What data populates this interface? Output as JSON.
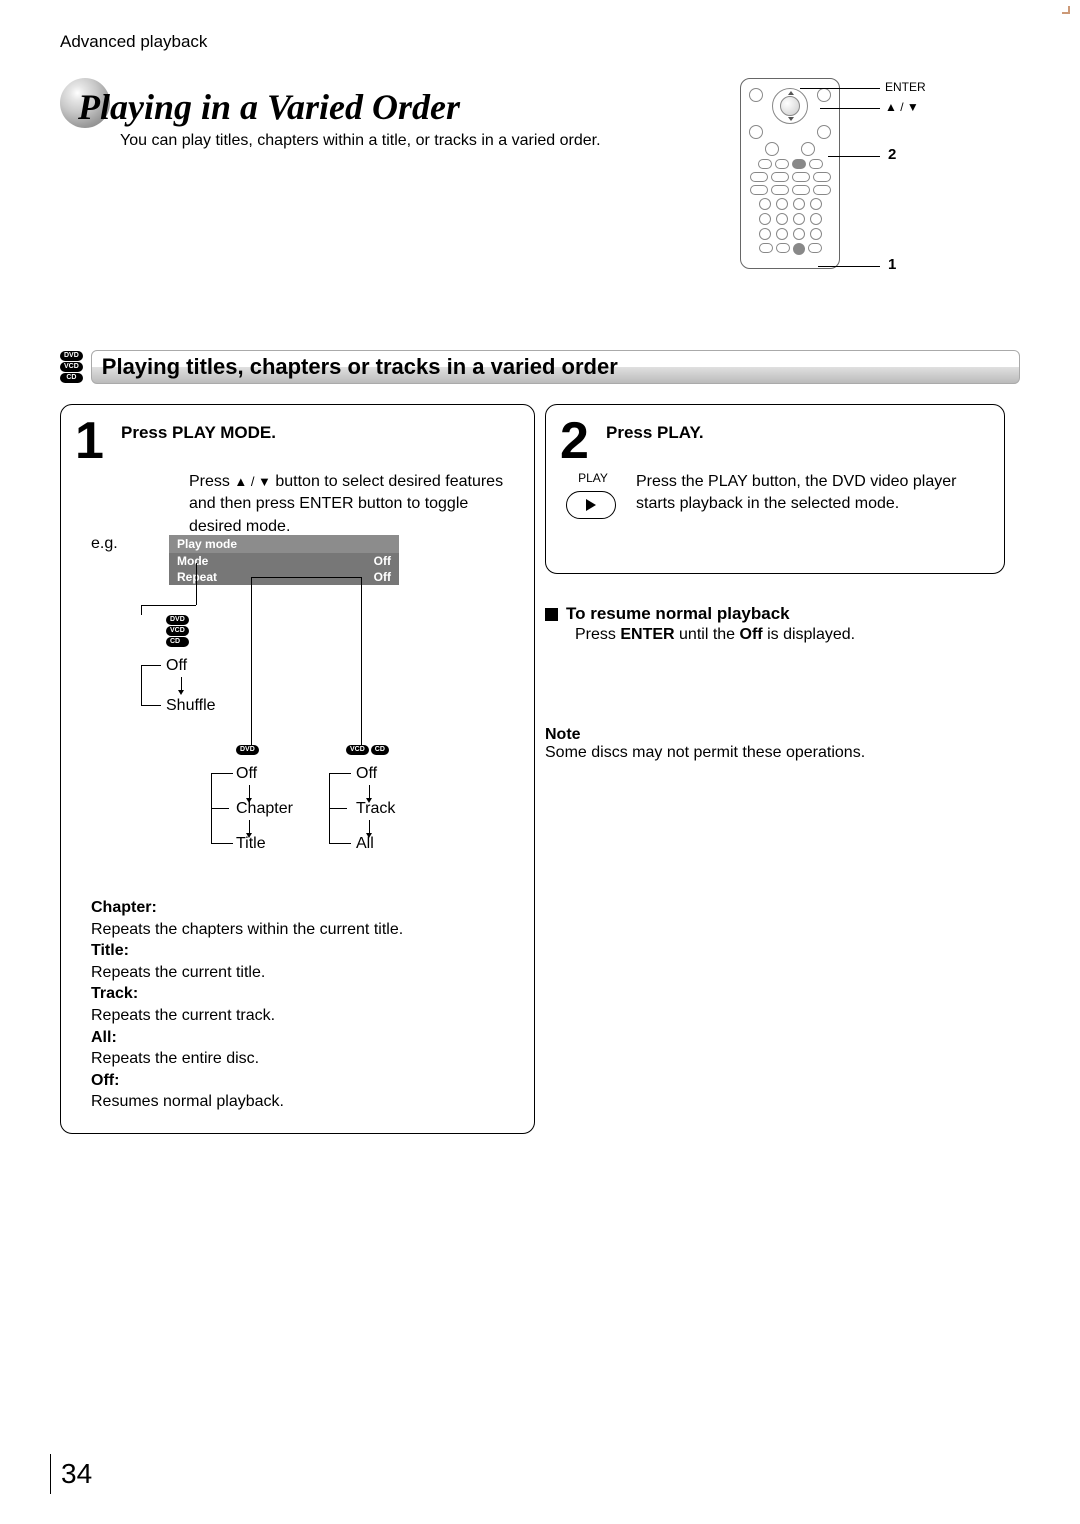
{
  "header": {
    "section": "Advanced playback",
    "title": "Playing in a Varied Order",
    "subtitle": "You can play titles, chapters within a title, or tracks in a varied order."
  },
  "remote_callouts": {
    "enter": "ENTER",
    "arrows": "▲ / ▼",
    "ref2": "2",
    "ref1": "1"
  },
  "disc_types": [
    "DVD",
    "VCD",
    "CD"
  ],
  "subheading": "Playing titles, chapters or tracks in a varied order",
  "step1": {
    "title": "Press PLAY MODE.",
    "instruction_pre": "Press ",
    "instruction_mid": " button to select desired features and then press ENTER button to toggle desired mode.",
    "eg": "e.g.",
    "osd": {
      "head": "Play mode",
      "rows": [
        {
          "label": "Mode",
          "value": "Off"
        },
        {
          "label": "Repeat",
          "value": "Off"
        }
      ]
    },
    "mode_branch": {
      "badges": [
        "DVD",
        "VCD",
        "CD"
      ],
      "opt1": "Off",
      "opt2": "Shuffle"
    },
    "repeat_branch_left": {
      "badges": [
        "DVD"
      ],
      "opt1": "Off",
      "opt2": "Chapter",
      "opt3": "Title"
    },
    "repeat_branch_right": {
      "badges": [
        "VCD",
        "CD"
      ],
      "opt1": "Off",
      "opt2": "Track",
      "opt3": "All"
    },
    "defs": [
      {
        "term": "Chapter:",
        "desc": "Repeats the chapters within the current title."
      },
      {
        "term": "Title:",
        "desc": "Repeats the current title."
      },
      {
        "term": "Track:",
        "desc": "Repeats the current track."
      },
      {
        "term": "All:",
        "desc": "Repeats the entire disc."
      },
      {
        "term": "Off:",
        "desc": "Resumes normal playback."
      }
    ]
  },
  "step2": {
    "title": "Press PLAY.",
    "play_label": "PLAY",
    "text": "Press the PLAY button, the DVD video player starts playback in the selected mode."
  },
  "resume": {
    "head": "To resume normal playback",
    "text_pre": "Press ",
    "text_b1": "ENTER",
    "text_mid": " until the ",
    "text_b2": "Off",
    "text_end": " is displayed."
  },
  "note": {
    "head": "Note",
    "text": "Some discs may not permit these operations."
  },
  "page_number": "34"
}
